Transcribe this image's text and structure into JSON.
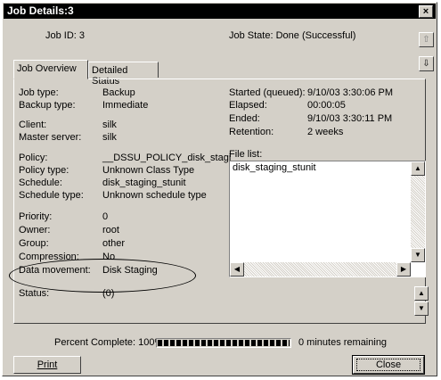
{
  "window": {
    "title": "Job Details:3",
    "close_glyph": "×"
  },
  "header": {
    "job_id": "Job ID: 3",
    "job_state": "Job State: Done (Successful)"
  },
  "nav": {
    "up_icon": "arrow-up-icon",
    "down_icon": "arrow-down-icon"
  },
  "tabs": [
    {
      "label": "Job Overview",
      "active": true
    },
    {
      "label": "Detailed Status",
      "active": false
    }
  ],
  "fields": [
    {
      "label": "Job type:",
      "value": "Backup"
    },
    {
      "label": "Backup type:",
      "value": "Immediate"
    },
    {
      "label": "Client:",
      "value": "silk"
    },
    {
      "label": "Master server:",
      "value": "silk"
    },
    {
      "label": "Policy:",
      "value": "__DSSU_POLICY_disk_stagi"
    },
    {
      "label": "Policy type:",
      "value": "Unknown Class Type"
    },
    {
      "label": "Schedule:",
      "value": "disk_staging_stunit"
    },
    {
      "label": "Schedule type:",
      "value": "Unknown schedule type"
    },
    {
      "label": "Priority:",
      "value": "0"
    },
    {
      "label": "Owner:",
      "value": "root"
    },
    {
      "label": "Group:",
      "value": "other"
    },
    {
      "label": "Compression:",
      "value": "No"
    },
    {
      "label": "Data movement:",
      "value": "Disk Staging"
    },
    {
      "label": "Status:",
      "value": "(0)"
    }
  ],
  "timing": [
    {
      "label": "Started (queued):",
      "value": "9/10/03 3:30:06 PM"
    },
    {
      "label": "Elapsed:",
      "value": "00:00:05"
    },
    {
      "label": "Ended:",
      "value": "9/10/03 3:30:11 PM"
    },
    {
      "label": "Retention:",
      "value": "2 weeks"
    }
  ],
  "file_list": {
    "label": "File list:",
    "items": [
      "disk_staging_stunit"
    ]
  },
  "footer": {
    "percent_complete": "Percent Complete: 100%",
    "progress": 1.0,
    "remaining": "0 minutes remaining",
    "print_label": "Print",
    "close_label": "Close"
  },
  "colors": {
    "window_bg": "#d4d0c8",
    "titlebar_bg": "#000000",
    "titlebar_text": "#ffffff"
  }
}
